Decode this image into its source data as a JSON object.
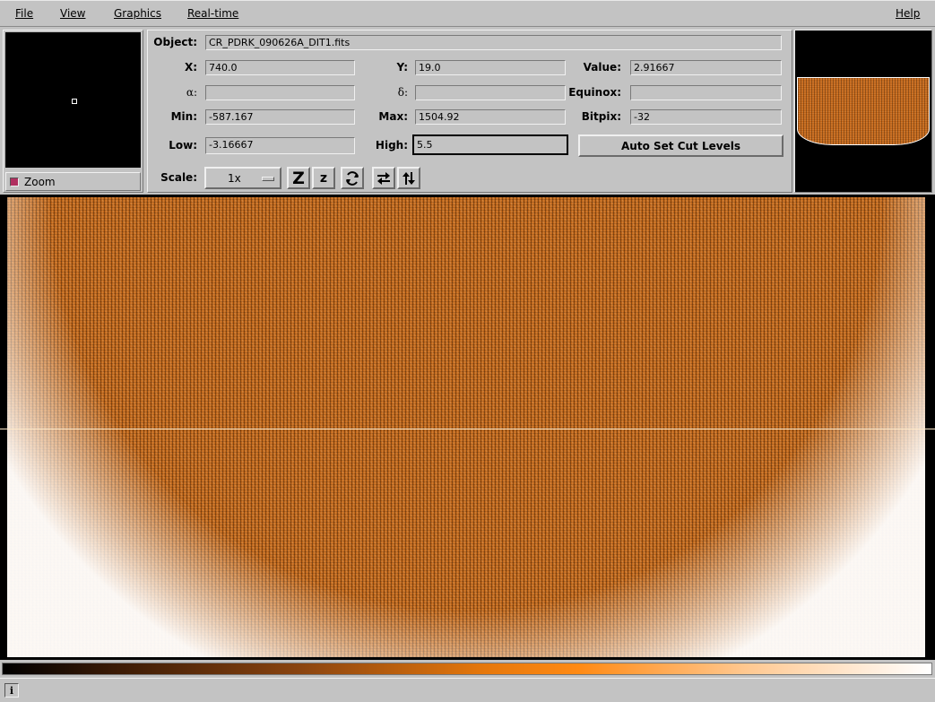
{
  "menu": {
    "file": "File",
    "view": "View",
    "graphics": "Graphics",
    "realtime": "Real-time",
    "help": "Help"
  },
  "zoom": {
    "label": "Zoom",
    "checked": true
  },
  "labels": {
    "object": "Object:",
    "x": "X:",
    "y": "Y:",
    "value": "Value:",
    "alpha": "α:",
    "delta": "δ:",
    "equinox": "Equinox:",
    "min": "Min:",
    "max": "Max:",
    "bitpix": "Bitpix:",
    "low": "Low:",
    "high": "High:",
    "scale": "Scale:"
  },
  "values": {
    "object": "CR_PDRK_090626A_DIT1.fits",
    "x": "740.0",
    "y": "19.0",
    "value": "2.91667",
    "alpha": "",
    "delta": "",
    "equinox": "",
    "min": "-587.167",
    "max": "1504.92",
    "bitpix": "-32",
    "low": "-3.16667",
    "high": "5.5"
  },
  "buttons": {
    "auto_cut": "Auto Set Cut Levels"
  },
  "scale": {
    "selected": "1x"
  },
  "tools": {
    "zoom_in": "Z",
    "zoom_out": "z"
  },
  "icons": [
    "zoom-in-icon",
    "zoom-out-icon",
    "rotate-icon",
    "flip-x-icon",
    "flip-y-icon",
    "info-icon"
  ],
  "colors": {
    "background": "#c3c3c3",
    "image": "#c46a1c",
    "check_on": "#b03060"
  },
  "status": {
    "icon_label": "i",
    "message": ""
  }
}
